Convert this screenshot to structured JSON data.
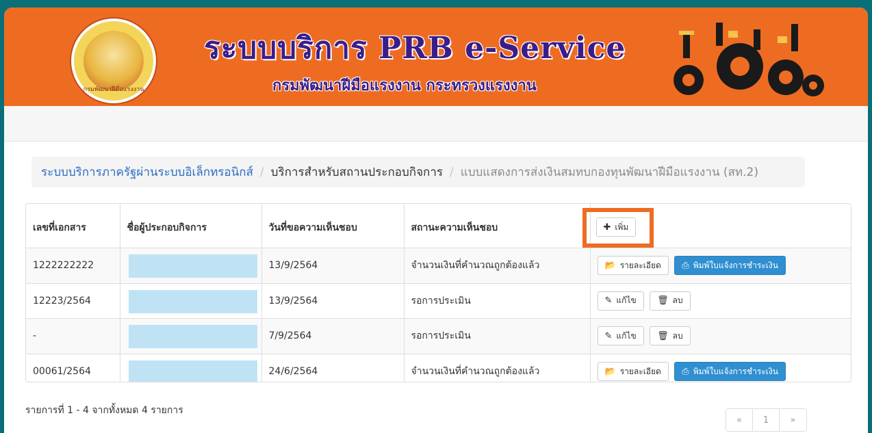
{
  "header": {
    "title": "ระบบบริการ PRB e-Service",
    "subtitle": "กรมพัฒนาฝีมือแรงงาน กระทรวงแรงงาน",
    "logo_text": "กรมพัฒนาฝีมือแรงงาน"
  },
  "breadcrumb": {
    "items": [
      "ระบบบริการภาครัฐผ่านระบบอิเล็กทรอนิกส์",
      "บริการสำหรับสถานประกอบกิจการ",
      "แบบแสดงการส่งเงินสมทบกองทุนพัฒนาฝีมือแรงงาน (สท.2)"
    ]
  },
  "table": {
    "headers": [
      "เลขที่เอกสาร",
      "ชื่อผู้ประกอบกิจการ",
      "วันที่ขอความเห็นชอบ",
      "สถานะความเห็นชอบ"
    ],
    "add_button": "เพิ่ม",
    "rows": [
      {
        "doc_no": "1222222222",
        "date": "13/9/2564",
        "status": "จำนวนเงินที่คำนวณถูกต้องแล้ว"
      },
      {
        "doc_no": "12223/2564",
        "date": "13/9/2564",
        "status": "รอการประเมิน"
      },
      {
        "doc_no": "-",
        "date": "7/9/2564",
        "status": "รอการประเมิน"
      },
      {
        "doc_no": "00061/2564",
        "date": "24/6/2564",
        "status": "จำนวนเงินที่คำนวณถูกต้องแล้ว"
      }
    ],
    "actions": {
      "detail": "รายละเอียด",
      "print": "พิมพ์ใบแจ้งการชำระเงิน",
      "edit": "แก้ไข",
      "delete": "ลบ"
    }
  },
  "footer": {
    "summary": "รายการที่ 1 - 4 จากทั้งหมด 4 รายการ"
  },
  "pagination": {
    "prev": "«",
    "page": "1",
    "next": "»"
  },
  "colors": {
    "header_bg": "#ee6c22",
    "title_color": "#3b1d8a",
    "link_blue": "#2a6cc4",
    "primary_button": "#2f8fd0",
    "highlight_box": "#ee6c22",
    "redaction": "#bfe3f5"
  }
}
